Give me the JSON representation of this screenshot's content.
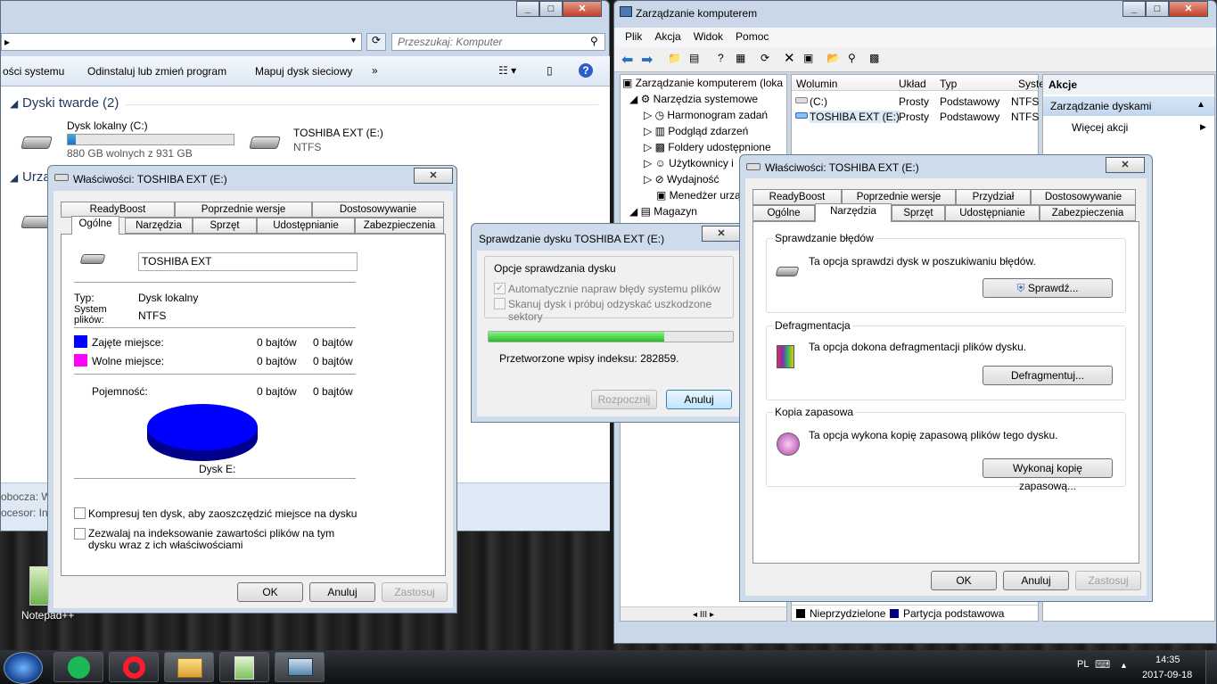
{
  "explorer": {
    "address_sep": "▸",
    "search_placeholder": "Przeszukaj: Komputer",
    "cmd_system": "ości systemu",
    "cmd_uninstall": "Odinstaluj lub zmień program",
    "cmd_map": "Mapuj dysk sieciowy",
    "cmd_more": "»",
    "section_hdd": "Dyski twarde (2)",
    "section_devices": "Urzą",
    "drive_c_name": "Dysk lokalny (C:)",
    "drive_c_free": "880 GB wolnych z 931 GB",
    "drive_c_used_fraction": 0.05,
    "drive_e_name": "TOSHIBA EXT (E:)",
    "drive_e_fs": "NTFS",
    "left_memory": "obocza:  W",
    "left_cpu": "ocesor:  Int"
  },
  "prop_left": {
    "title": "Właściwości: TOSHIBA EXT (E:)",
    "tabs_row1": [
      "ReadyBoost",
      "Poprzednie wersje",
      "Dostosowywanie"
    ],
    "tabs_row2": [
      "Ogólne",
      "Narzędzia",
      "Sprzęt",
      "Udostępnianie",
      "Zabezpieczenia"
    ],
    "label_value": "TOSHIBA EXT",
    "type_label": "Typ:",
    "type_value": "Dysk lokalny",
    "fs_label": "System plików:",
    "fs_value": "NTFS",
    "used_label": "Zajęte miejsce:",
    "used_b1": "0 bajtów",
    "used_b2": "0 bajtów",
    "free_label": "Wolne miejsce:",
    "free_b1": "0 bajtów",
    "free_b2": "0 bajtów",
    "cap_label": "Pojemność:",
    "cap_b1": "0 bajtów",
    "cap_b2": "0 bajtów",
    "disk_label": "Dysk E:",
    "compress": "Kompresuj ten dysk, aby zaoszczędzić miejsce na dysku",
    "index": "Zezwalaj na indeksowanie zawartości plików na tym dysku wraz z ich właściwościami",
    "ok": "OK",
    "cancel": "Anuluj",
    "apply": "Zastosuj",
    "used_color": "#0000ff",
    "free_color": "#ff00ff"
  },
  "chkdsk": {
    "title": "Sprawdzanie dysku TOSHIBA EXT (E:)",
    "group": "Opcje sprawdzania dysku",
    "opt1": "Automatycznie napraw błędy systemu plików",
    "opt2": "Skanuj dysk i próbuj odzyskać uszkodzone sektory",
    "progress": 0.72,
    "status": "Przetworzone wpisy indeksu: 282859.",
    "start": "Rozpocznij",
    "cancel": "Anuluj"
  },
  "mgmt": {
    "title": "Zarządzanie komputerem",
    "menu": [
      "Plik",
      "Akcja",
      "Widok",
      "Pomoc"
    ],
    "tree": [
      "Zarządzanie komputerem (loka",
      "Narzędzia systemowe",
      "Harmonogram zadań",
      "Podgląd zdarzeń",
      "Foldery udostępnione",
      "Użytkownicy i",
      "Wydajność",
      "Menedżer urzą",
      "Magazyn"
    ],
    "cols": [
      "Wolumin",
      "Układ",
      "Typ",
      "Syster"
    ],
    "rows": [
      [
        "(C:)",
        "Prosty",
        "Podstawowy",
        "NTFS"
      ],
      [
        "TOSHIBA EXT (E:)",
        "Prosty",
        "Podstawowy",
        "NTFS"
      ]
    ],
    "actions_hdr": "Akcje",
    "actions_sel": "Zarządzanie dyskami",
    "actions_more": "Więcej akcji",
    "legend1": "Nieprzydzielone",
    "legend2": "Partycja podstawowa",
    "scroll": "III"
  },
  "prop_right": {
    "title": "Właściwości: TOSHIBA EXT (E:)",
    "tabs_row1": [
      "ReadyBoost",
      "Poprzednie wersje",
      "Przydział",
      "Dostosowywanie"
    ],
    "tabs_row2": [
      "Ogólne",
      "Narzędzia",
      "Sprzęt",
      "Udostępnianie",
      "Zabezpieczenia"
    ],
    "g1": "Sprawdzanie błędów",
    "g1_text": "Ta opcja sprawdzi dysk w poszukiwaniu błędów.",
    "g1_btn": "Sprawdź...",
    "g2": "Defragmentacja",
    "g2_text": "Ta opcja dokona defragmentacji plików dysku.",
    "g2_btn": "Defragmentuj...",
    "g3": "Kopia zapasowa",
    "g3_text": "Ta opcja wykona kopię zapasową plików tego dysku.",
    "g3_btn": "Wykonaj kopię zapasową...",
    "ok": "OK",
    "cancel": "Anuluj",
    "apply": "Zastosuj"
  },
  "desktop": {
    "notepad": "Notepad++"
  },
  "tray": {
    "lang": "PL",
    "time": "14:35",
    "date": "2017-09-18"
  }
}
